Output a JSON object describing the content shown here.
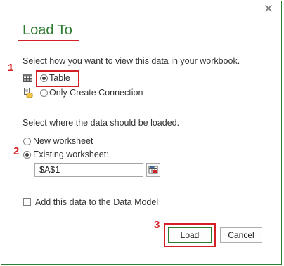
{
  "dialog": {
    "title": "Load To",
    "close_symbol": "✕"
  },
  "view_section": {
    "prompt": "Select how you want to view this data in your workbook.",
    "options": [
      {
        "label": "Table",
        "selected": true,
        "icon": "table-icon"
      },
      {
        "label": "Only Create Connection",
        "selected": false,
        "icon": "connection-icon"
      }
    ]
  },
  "location_section": {
    "prompt": "Select where the data should be loaded.",
    "options": [
      {
        "label": "New worksheet",
        "selected": false
      },
      {
        "label": "Existing worksheet:",
        "selected": true
      }
    ],
    "cell_reference": "$A$1",
    "range_picker_icon": "range-select-icon"
  },
  "data_model": {
    "label": "Add this data to the Data Model",
    "checked": false
  },
  "buttons": {
    "load_label": "Load",
    "cancel_label": "Cancel"
  },
  "annotations": {
    "marker_1": "1",
    "marker_2": "2",
    "marker_3": "3",
    "highlight_color": "#d51f26"
  },
  "colors": {
    "accent": "#2e7d32",
    "annotation": "#d51f26"
  }
}
